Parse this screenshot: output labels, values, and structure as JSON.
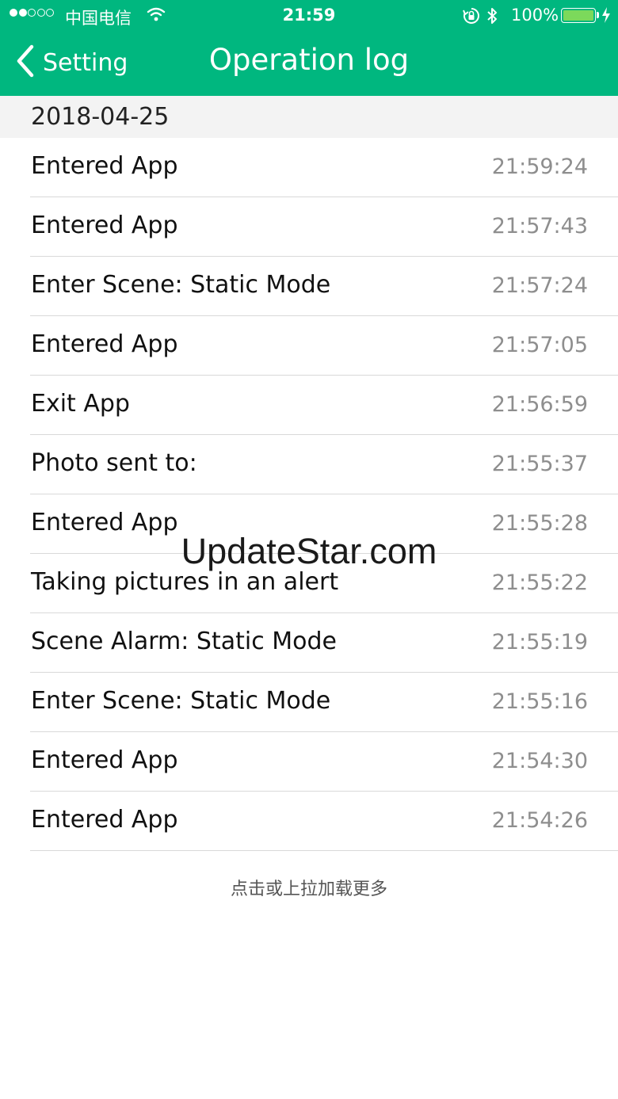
{
  "status_bar": {
    "carrier": "中国电信",
    "time": "21:59",
    "battery_percent": "100%",
    "battery_level": 1.0,
    "icons": [
      "signal-dots-icon",
      "wifi-icon",
      "rotation-lock-icon",
      "bluetooth-icon",
      "battery-icon",
      "charging-bolt-icon"
    ]
  },
  "nav": {
    "back_label": "Setting",
    "title": "Operation log"
  },
  "section": {
    "date": "2018-04-25"
  },
  "log": [
    {
      "event": "Entered App",
      "time": "21:59:24"
    },
    {
      "event": "Entered App",
      "time": "21:57:43"
    },
    {
      "event": "Enter Scene: Static Mode",
      "time": "21:57:24"
    },
    {
      "event": "Entered App",
      "time": "21:57:05"
    },
    {
      "event": "Exit App",
      "time": "21:56:59"
    },
    {
      "event": "Photo sent to:",
      "time": "21:55:37"
    },
    {
      "event": "Entered App",
      "time": "21:55:28"
    },
    {
      "event": "Taking pictures in an alert",
      "time": "21:55:22"
    },
    {
      "event": "Scene Alarm: Static Mode",
      "time": "21:55:19"
    },
    {
      "event": "Enter Scene: Static Mode",
      "time": "21:55:16"
    },
    {
      "event": "Entered App",
      "time": "21:54:30"
    },
    {
      "event": "Entered App",
      "time": "21:54:26"
    }
  ],
  "footer": {
    "load_more": "点击或上拉加载更多"
  },
  "watermark": "UpdateStar.com",
  "colors": {
    "header_bg": "#00b77f",
    "section_bg": "#f3f3f3",
    "time_text": "#8e8e8e",
    "battery_fill": "#7cd95b"
  }
}
